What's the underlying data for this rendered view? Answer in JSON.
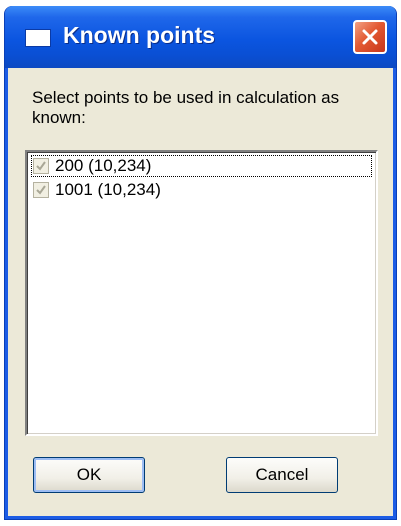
{
  "window": {
    "title": "Known points",
    "icon": "window-icon",
    "close_icon": "close-icon"
  },
  "prompt": "Select points to be used in calculation as known:",
  "points": [
    {
      "label": "200 (10,234)",
      "checked": true,
      "focused": true
    },
    {
      "label": "1001 (10,234)",
      "checked": true,
      "focused": false
    }
  ],
  "buttons": {
    "ok_label": "OK",
    "cancel_label": "Cancel"
  },
  "colors": {
    "titlebar": "#0b55e0",
    "window_body": "#ece9d8",
    "close_button": "#e35a33",
    "checkmark_disabled": "#a9a796"
  }
}
